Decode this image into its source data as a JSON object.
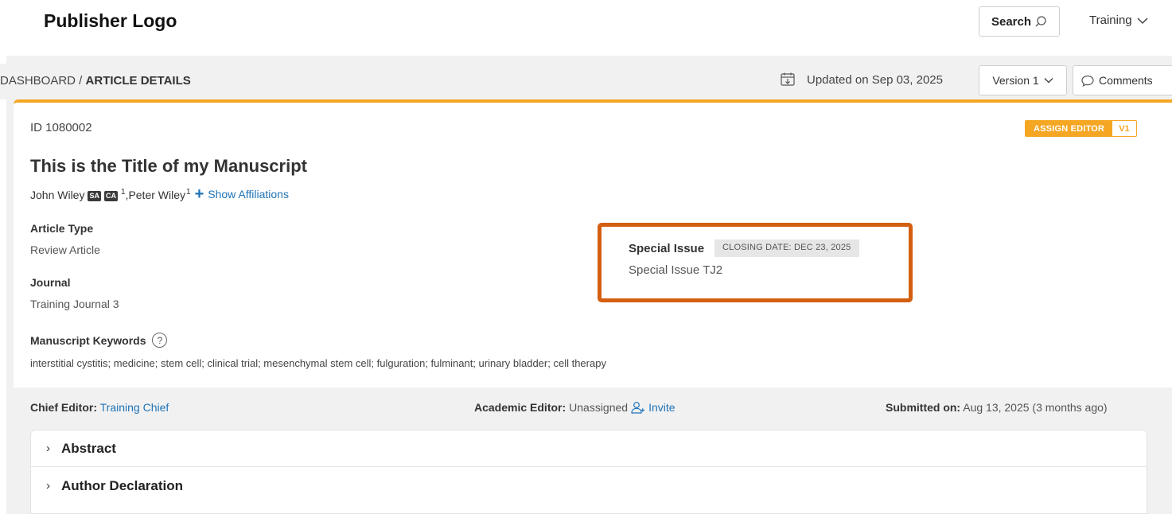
{
  "header": {
    "logo_text": "Publisher Logo",
    "search_label": "Search",
    "user_menu_label": "Training"
  },
  "subheader": {
    "breadcrumb_root": "DASHBOARD /",
    "breadcrumb_current": "ARTICLE DETAILS",
    "updated_text": "Updated on Sep 03, 2025",
    "version_label": "Version 1",
    "comments_label": "Comments"
  },
  "article": {
    "id_text": "ID 1080002",
    "assign_editor_label": "ASSIGN EDITOR",
    "version_badge": "V1",
    "title": "This is the Title of my Manuscript",
    "authors": [
      {
        "name": "John Wiley",
        "badges": [
          "SA",
          "CA"
        ],
        "affiliation": "1"
      },
      {
        "name": "Peter Wiley",
        "badges": [],
        "affiliation": "1"
      }
    ],
    "author_separator": ", ",
    "show_affiliations_label": "Show Affiliations",
    "article_type_label": "Article Type",
    "article_type_value": "Review Article",
    "journal_label": "Journal",
    "journal_value": "Training Journal 3",
    "special_issue_label": "Special Issue",
    "closing_date": "CLOSING DATE: DEC 23, 2025",
    "special_issue_value": "Special Issue TJ2",
    "keywords_label": "Manuscript Keywords",
    "keywords_value": "interstitial cystitis; medicine; stem cell; clinical trial; mesenchymal stem cell; fulguration; fulminant; urinary bladder; cell therapy"
  },
  "editors": {
    "chief_label": "Chief Editor:",
    "chief_value": "Training Chief",
    "academic_label": "Academic Editor:",
    "academic_value": "Unassigned",
    "invite_label": "Invite",
    "submitted_label": "Submitted on:",
    "submitted_value": "Aug 13, 2025 (3 months ago)"
  },
  "sections": [
    {
      "label": "Abstract"
    },
    {
      "label": "Author Declaration"
    }
  ],
  "colors": {
    "accent_orange": "#f5a623",
    "highlight_box": "#d35f11",
    "link_blue": "#1f73b7"
  }
}
